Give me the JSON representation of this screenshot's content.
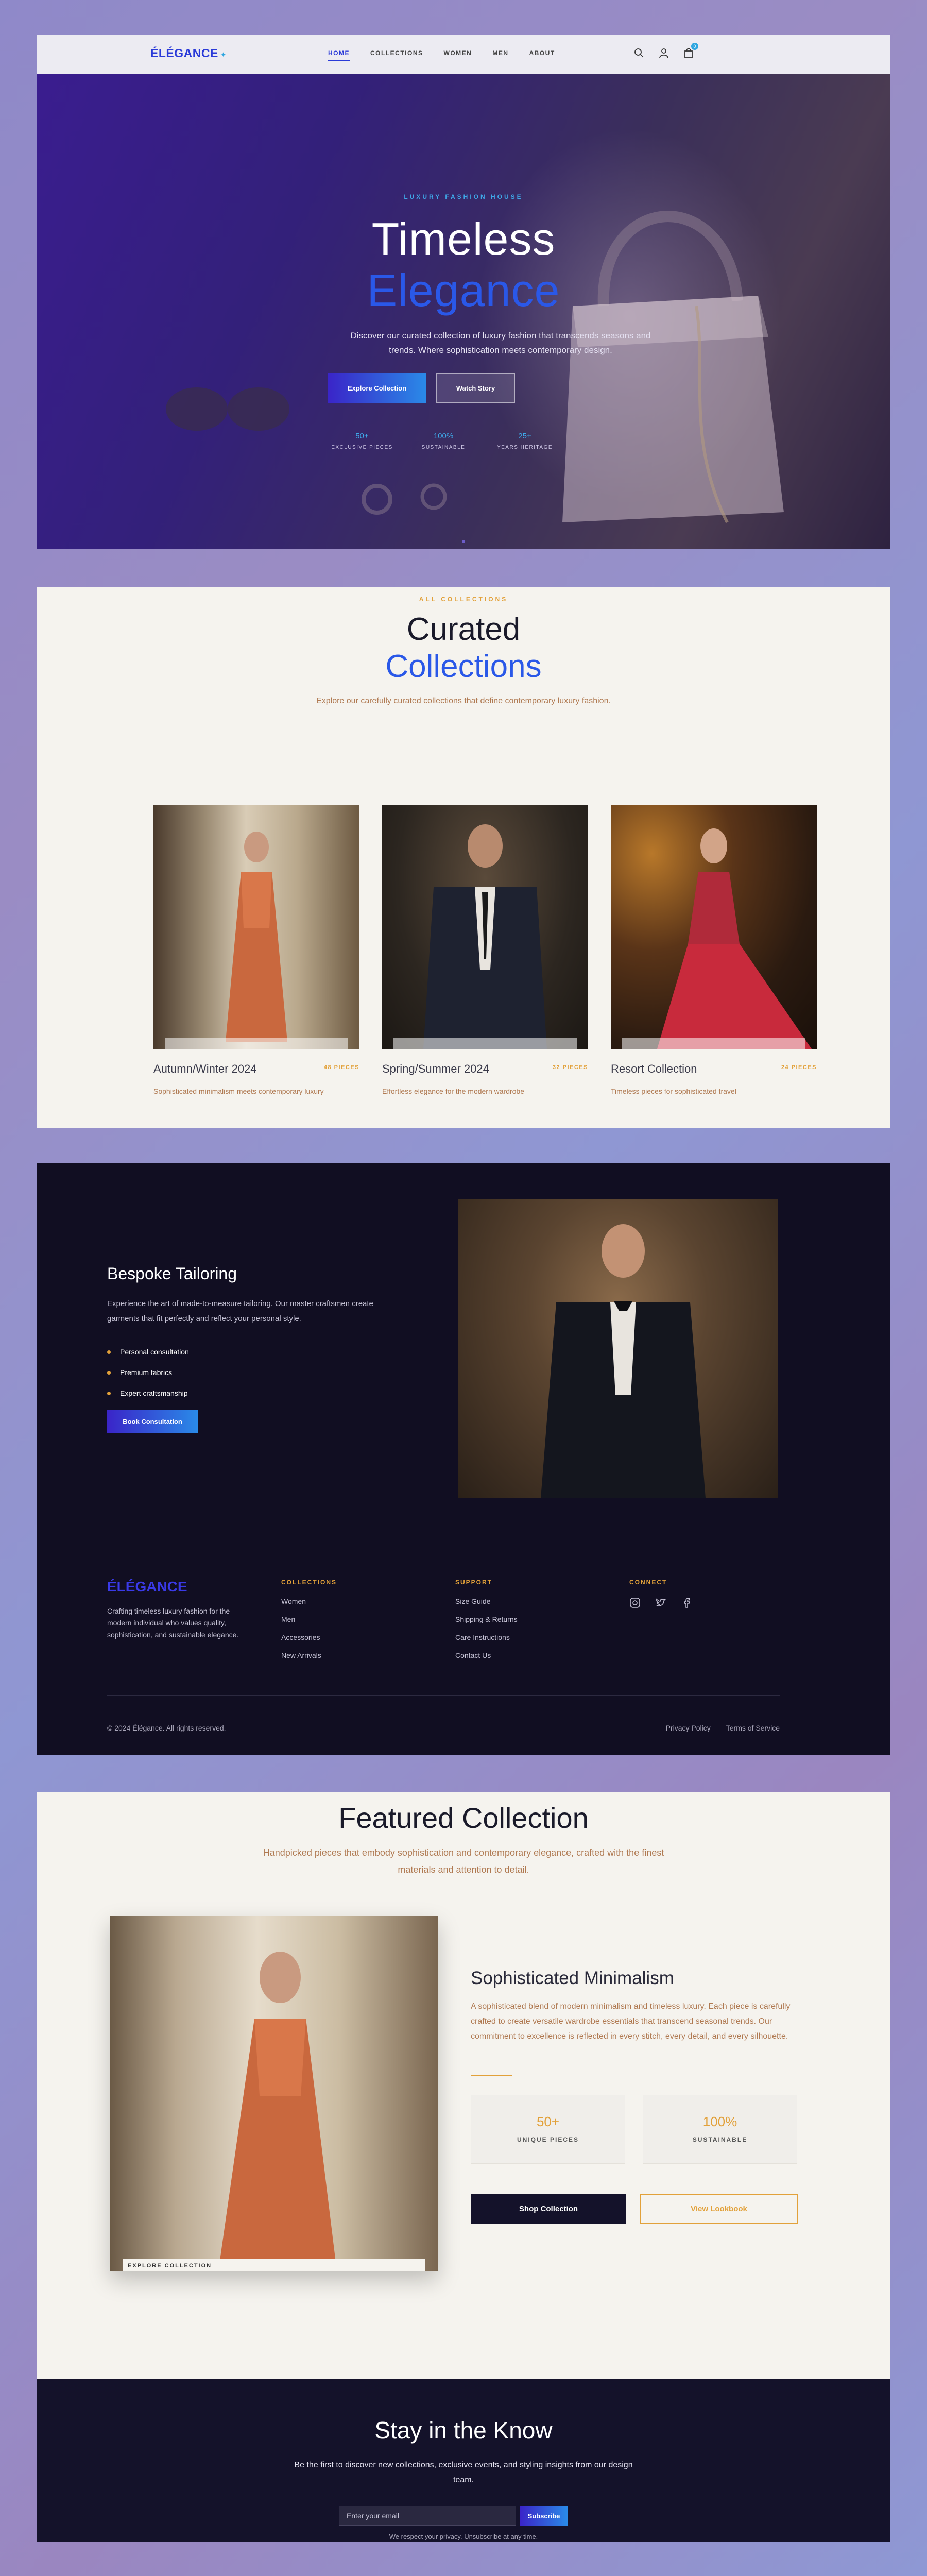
{
  "brand": {
    "logo": "ÉLÉGANCE",
    "logo_mark": "✦"
  },
  "nav": {
    "links": [
      "HOME",
      "COLLECTIONS",
      "WOMEN",
      "MEN",
      "ABOUT"
    ],
    "active": "HOME",
    "cart_count": "0",
    "icons": [
      "search-icon",
      "user-icon",
      "bag-icon"
    ]
  },
  "hero": {
    "eyebrow": "LUXURY FASHION HOUSE",
    "title_line1": "Timeless",
    "title_line2": "Elegance",
    "description": "Discover our curated collection of luxury fashion that transcends seasons and trends. Where sophistication meets contemporary design.",
    "primary_button": "Explore Collection",
    "secondary_button": "Watch Story",
    "stats": [
      {
        "value": "50+",
        "label": "EXCLUSIVE PIECES"
      },
      {
        "value": "100%",
        "label": "SUSTAINABLE"
      },
      {
        "value": "25+",
        "label": "YEARS HERITAGE"
      }
    ]
  },
  "collections": {
    "eyebrow": "ALL COLLECTIONS",
    "title_line1": "Curated",
    "title_line2": "Collections",
    "description": "Explore our carefully curated collections that define contemporary luxury fashion.",
    "items": [
      {
        "name": "Autumn/Winter 2024",
        "count": "48 PIECES",
        "description": "Sophisticated minimalism meets contemporary luxury"
      },
      {
        "name": "Spring/Summer 2024",
        "count": "32 PIECES",
        "description": "Effortless elegance for the modern wardrobe"
      },
      {
        "name": "Resort Collection",
        "count": "24 PIECES",
        "description": "Timeless pieces for sophisticated travel"
      }
    ]
  },
  "bespoke": {
    "title": "Bespoke Tailoring",
    "description": "Experience the art of made-to-measure tailoring. Our master craftsmen create garments that fit perfectly and reflect your personal style.",
    "features": [
      "Personal consultation",
      "Premium fabrics",
      "Expert craftsmanship"
    ],
    "button": "Book Consultation"
  },
  "footer": {
    "logo": "ÉLÉGANCE",
    "about": "Crafting timeless luxury fashion for the modern individual who values quality, sophistication, and sustainable elegance.",
    "columns": [
      {
        "heading": "COLLECTIONS",
        "links": [
          "Women",
          "Men",
          "Accessories",
          "New Arrivals"
        ]
      },
      {
        "heading": "SUPPORT",
        "links": [
          "Size Guide",
          "Shipping & Returns",
          "Care Instructions",
          "Contact Us"
        ]
      }
    ],
    "connect_heading": "CONNECT",
    "social_icons": [
      "instagram-icon",
      "twitter-icon",
      "facebook-icon"
    ],
    "copyright": "© 2024 Élégance. All rights reserved.",
    "legal": [
      "Privacy Policy",
      "Terms of Service"
    ]
  },
  "featured": {
    "title": "Featured Collection",
    "description": "Handpicked pieces that embody sophistication and contemporary elegance, crafted with the finest materials and attention to detail.",
    "image_caption": "EXPLORE COLLECTION",
    "subtitle": "Sophisticated Minimalism",
    "body": "A sophisticated blend of modern minimalism and timeless luxury. Each piece is carefully crafted to create versatile wardrobe essentials that transcend seasonal trends. Our commitment to excellence is reflected in every stitch, every detail, and every silhouette.",
    "stats": [
      {
        "value": "50+",
        "label": "UNIQUE PIECES"
      },
      {
        "value": "100%",
        "label": "SUSTAINABLE"
      }
    ],
    "primary_button": "Shop Collection",
    "secondary_button": "View Lookbook"
  },
  "newsletter": {
    "title": "Stay in the Know",
    "description": "Be the first to discover new collections, exclusive events, and styling insights from our design team.",
    "placeholder": "Enter your email",
    "button": "Subscribe",
    "note": "We respect your privacy. Unsubscribe at any time."
  },
  "colors": {
    "accent_blue": "#2a58e8",
    "accent_gold": "#e2a13a",
    "dark_bg": "#110e22",
    "cream_bg": "#f5f3ee"
  }
}
